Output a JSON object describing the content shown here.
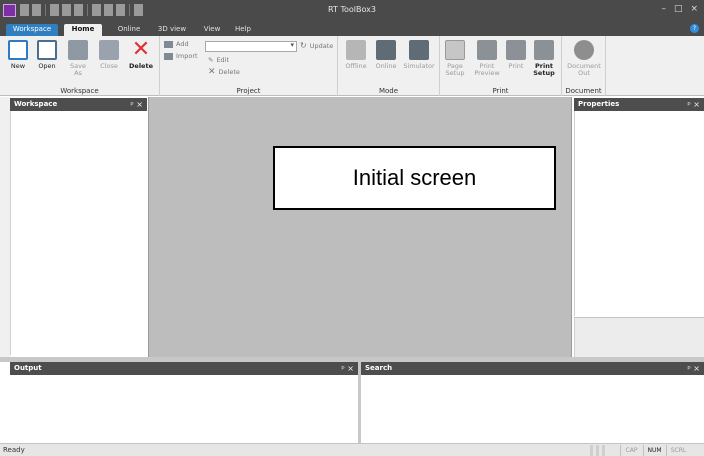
{
  "window": {
    "title": "RT ToolBox3",
    "minimize_glyph": "–",
    "maximize_glyph": "□",
    "close_glyph": "×"
  },
  "ribbon_tabs": [
    {
      "label": "Workspace"
    },
    {
      "label": "Home"
    },
    {
      "label": "Online"
    },
    {
      "label": "3D view"
    },
    {
      "label": "View"
    },
    {
      "label": "Help"
    }
  ],
  "help_glyph": "?",
  "ribbon": {
    "workspace_group": {
      "label": "Workspace",
      "new": "New",
      "open": "Open",
      "save_as": "Save As",
      "close": "Close",
      "delete": "Delete"
    },
    "project_group": {
      "label": "Project",
      "add": "Add",
      "import": "Import",
      "edit": "Edit",
      "delete": "Delete",
      "update": "Update",
      "combo_value": ""
    },
    "mode_group": {
      "label": "Mode",
      "offline": "Offline",
      "online": "Online",
      "simulator": "Simulator"
    },
    "print_group": {
      "label": "Print",
      "page_setup": "Page Setup",
      "print_preview": "Print Preview",
      "print": "Print",
      "print_setup": "Print Setup"
    },
    "document_group": {
      "label": "Document",
      "document_out": "Document Out"
    }
  },
  "panels": {
    "workspace": {
      "title": "Workspace"
    },
    "properties": {
      "title": "Properties"
    },
    "output": {
      "title": "Output"
    },
    "search": {
      "title": "Search"
    },
    "pin_glyph": "ᵖ ×"
  },
  "center": {
    "annotation": "Initial screen"
  },
  "statusbar": {
    "status": "Ready",
    "cap": "CAP",
    "num": "NUM",
    "scrl": "SCRL"
  }
}
